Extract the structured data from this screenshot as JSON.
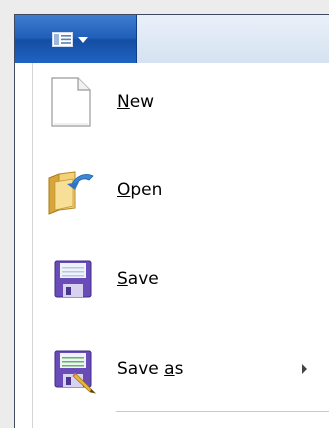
{
  "menu": {
    "items": [
      {
        "id": "new",
        "icon": "blank-document-icon",
        "parts": [
          "",
          "N",
          "ew"
        ],
        "has_submenu": false
      },
      {
        "id": "open",
        "icon": "open-folder-icon",
        "parts": [
          "",
          "O",
          "pen"
        ],
        "has_submenu": false
      },
      {
        "id": "save",
        "icon": "floppy-disk-icon",
        "parts": [
          "",
          "S",
          "ave"
        ],
        "has_submenu": false
      },
      {
        "id": "save-as",
        "icon": "save-as-icon",
        "parts": [
          "Save ",
          "a",
          "s"
        ],
        "has_submenu": true
      }
    ]
  },
  "colors": {
    "app_button": "#1f5fb9",
    "ribbon": "#dde7f4",
    "floppy": "#6a4cb8"
  }
}
